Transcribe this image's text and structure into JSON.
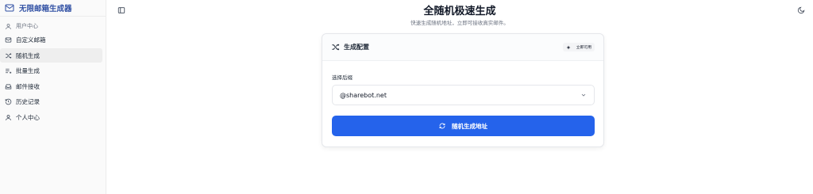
{
  "sidebar": {
    "brand": "无限邮箱生成器",
    "section_label": "用户中心",
    "items": [
      {
        "label": "自定义邮箱",
        "icon": "inbox-icon",
        "active": false
      },
      {
        "label": "随机生成",
        "icon": "shuffle-icon",
        "active": true
      },
      {
        "label": "批量生成",
        "icon": "list-plus-icon",
        "active": false
      },
      {
        "label": "邮件接收",
        "icon": "mail-tray-icon",
        "active": false
      },
      {
        "label": "历史记录",
        "icon": "history-icon",
        "active": false
      },
      {
        "label": "个人中心",
        "icon": "user-icon",
        "active": false
      }
    ]
  },
  "header": {
    "title": "全随机极速生成",
    "subtitle": "快速生成随机地址，立即可接收真实邮件。"
  },
  "card": {
    "title": "生成配置",
    "badge": "立即可用",
    "field_label": "选择后缀",
    "select_value": "@sharebot.net",
    "button_label": "随机生成地址"
  },
  "colors": {
    "accent": "#2563eb",
    "brand": "#2f4fa3"
  }
}
